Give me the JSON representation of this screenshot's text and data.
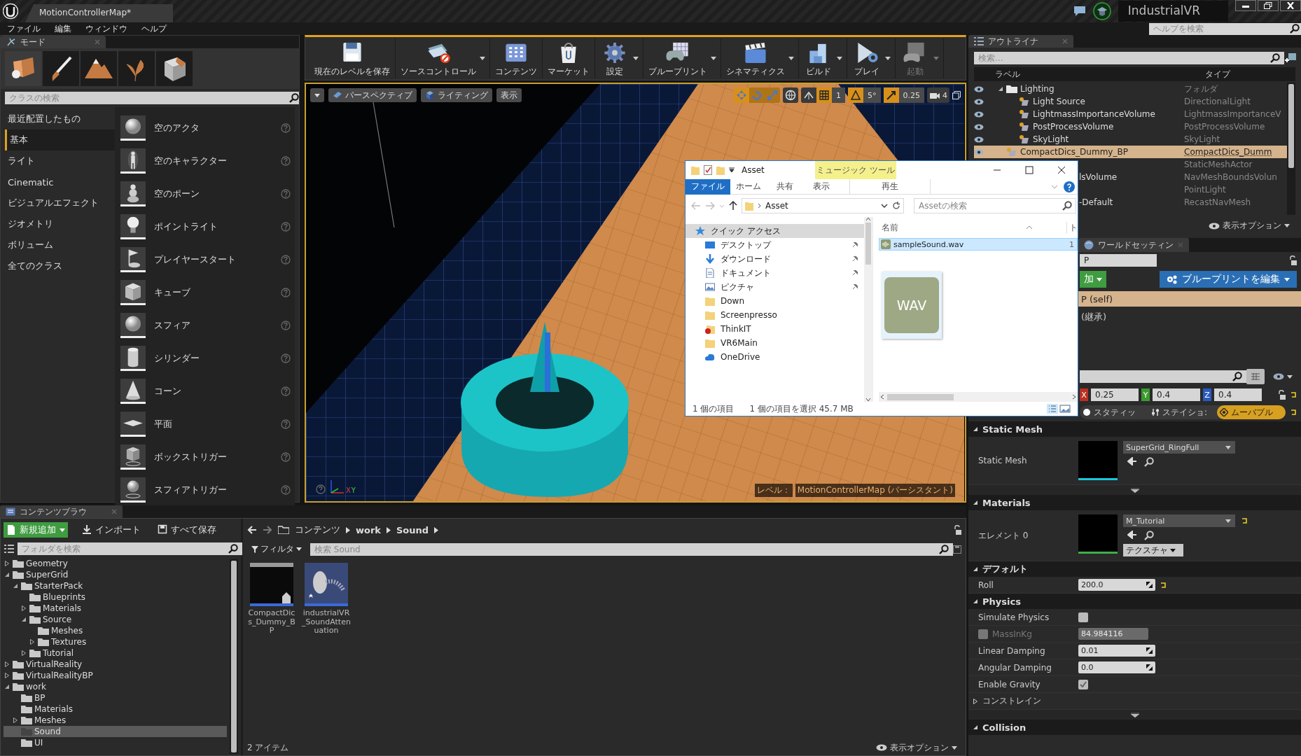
{
  "title_bar": {
    "tab": "MotionControllerMap*",
    "project": "IndustrialVR"
  },
  "menu": [
    "ファイル",
    "編集",
    "ウィンドウ",
    "ヘルプ"
  ],
  "help_search": {
    "placeholder": "ヘルプを検索"
  },
  "modes": {
    "tab": "モード",
    "tools": [
      {
        "kind": "place",
        "selected": true
      },
      {
        "kind": "paint",
        "selected": false
      },
      {
        "kind": "landscape",
        "selected": false
      },
      {
        "kind": "foliage",
        "selected": false
      },
      {
        "kind": "geometry",
        "selected": false
      }
    ],
    "search": {
      "placeholder": "クラスの検索"
    },
    "categories": [
      {
        "label": "最近配置したもの",
        "selected": false
      },
      {
        "label": "基本",
        "selected": true
      },
      {
        "label": "ライト",
        "selected": false
      },
      {
        "label": "Cinematic",
        "selected": false
      },
      {
        "label": "ビジュアルエフェクト",
        "selected": false
      },
      {
        "label": "ジオメトリ",
        "selected": false
      },
      {
        "label": "ボリューム",
        "selected": false
      },
      {
        "label": "全てのクラス",
        "selected": false
      }
    ],
    "items": [
      {
        "label": "空のアクタ",
        "kind": "sphere"
      },
      {
        "label": "空のキャラクター",
        "kind": "figure"
      },
      {
        "label": "空のポーン",
        "kind": "pawn"
      },
      {
        "label": "ポイントライト",
        "kind": "bulb"
      },
      {
        "label": "プレイヤースタート",
        "kind": "flag"
      },
      {
        "label": "キューブ",
        "kind": "cube"
      },
      {
        "label": "スフィア",
        "kind": "sphere"
      },
      {
        "label": "シリンダー",
        "kind": "cylinder"
      },
      {
        "label": "コーン",
        "kind": "cone"
      },
      {
        "label": "平面",
        "kind": "plane"
      },
      {
        "label": "ボックストリガー",
        "kind": "boxtrigger"
      },
      {
        "label": "スフィアトリガー",
        "kind": "spheretrigger"
      }
    ]
  },
  "toolbar": [
    {
      "label": "現在のレベルを保存",
      "kind": "save",
      "dropdown": false,
      "disabled": false
    },
    {
      "label": "ソースコントロール",
      "kind": "source",
      "dropdown": true,
      "disabled": false
    },
    {
      "label": "コンテンツ",
      "kind": "content",
      "dropdown": false,
      "disabled": false
    },
    {
      "label": "マーケット",
      "kind": "market",
      "dropdown": false,
      "disabled": false
    },
    {
      "label": "設定",
      "kind": "settings",
      "dropdown": true,
      "disabled": false
    },
    {
      "label": "ブループリント",
      "kind": "blueprint",
      "dropdown": true,
      "disabled": false
    },
    {
      "label": "シネマティクス",
      "kind": "cinematics",
      "dropdown": true,
      "disabled": false
    },
    {
      "label": "ビルド",
      "kind": "build",
      "dropdown": true,
      "disabled": false
    },
    {
      "label": "プレイ",
      "kind": "play",
      "dropdown": true,
      "disabled": false
    },
    {
      "label": "起動",
      "kind": "launch",
      "dropdown": true,
      "disabled": true
    }
  ],
  "viewport": {
    "buttons": [
      {
        "label": "パースペクティブ",
        "kind": "perspective"
      },
      {
        "label": "ライティング",
        "kind": "lighting"
      },
      {
        "label": "表示",
        "kind": "show"
      }
    ],
    "transform_modes": [
      {
        "kind": "move",
        "selected": true
      },
      {
        "kind": "rotate",
        "selected": false
      },
      {
        "kind": "scale",
        "selected": false
      }
    ],
    "snaps": [
      {
        "kind": "grid",
        "value": "1",
        "on": true
      },
      {
        "kind": "angle",
        "value": "5°",
        "on": true
      },
      {
        "kind": "scale",
        "value": "0.25",
        "on": true
      }
    ],
    "camera_speed": "4",
    "axis_labels": [
      "X",
      "Y"
    ],
    "level_prefix": "レベル：",
    "level_name": "MotionControllerMap (パーシスタント)"
  },
  "outliner": {
    "tab": "アウトライナ",
    "search": {
      "placeholder": "検索..."
    },
    "columns": [
      "ラベル",
      "タイプ"
    ],
    "rows": [
      {
        "label": "Lighting",
        "type": "フォルダ",
        "kind": "folder",
        "expanded": true,
        "selected": false,
        "children": [
          {
            "label": "Light Source",
            "type": "DirectionalLight",
            "kind": "actor",
            "selected": false
          },
          {
            "label": "LightmassImportanceVolume",
            "type": "LightmassImportanceV",
            "kind": "actor",
            "selected": false
          },
          {
            "label": "PostProcessVolume",
            "type": "PostProcessVolume",
            "kind": "actor",
            "selected": false
          },
          {
            "label": "SkyLight",
            "type": "SkyLight",
            "kind": "actor",
            "selected": false
          }
        ]
      },
      {
        "label": "CompactDics_Dummy_BP",
        "type": "CompactDics_Dumm",
        "kind": "actor",
        "selected": true
      },
      {
        "type": "StaticMeshActor",
        "kind": "partial",
        "selected": false
      },
      {
        "label": "lsVolume",
        "type": "NavMeshBoundsVolun",
        "kind": "partial",
        "selected": false
      },
      {
        "type": "PointLight",
        "kind": "partial",
        "selected": false
      },
      {
        "label": "-Default",
        "type": "RecastNavMesh",
        "kind": "partial",
        "selected": false
      }
    ],
    "view_options": "表示オプション"
  },
  "details": {
    "tab": "ワールドセッティン",
    "name_fragment": "P",
    "add_button": "加",
    "edit_blueprint": "ブループリントを編集",
    "components": [
      {
        "label": "P (self)",
        "selected": true
      },
      {
        "label": "(継承)",
        "selected": false
      }
    ],
    "transform": [
      {
        "axis": "X",
        "value": "0.25"
      },
      {
        "axis": "Y",
        "value": "0.4"
      },
      {
        "axis": "Z",
        "value": "0.4"
      }
    ],
    "mobility": [
      {
        "label": "スタティッ",
        "kind": "static",
        "selected": false
      },
      {
        "label": "ステイショ:",
        "kind": "stationary",
        "selected": false
      },
      {
        "label": "ムーバブル",
        "kind": "movable",
        "selected": true
      }
    ],
    "sections": [
      {
        "title": "Static Mesh",
        "expanded": true,
        "advanced": true,
        "rows": [
          {
            "kind": "asset",
            "label": "Static Mesh",
            "value": "SuperGrid_RingFull",
            "color": "#19c8dc",
            "reset": false
          }
        ]
      },
      {
        "title": "Materials",
        "expanded": true,
        "advanced": false,
        "rows": [
          {
            "kind": "asset",
            "label": "エレメント 0",
            "value": "M_Tutorial",
            "button": "テクスチャ",
            "color": "#3fae4a",
            "reset": true
          }
        ]
      },
      {
        "title": "デフォルト",
        "expanded": true,
        "advanced": false,
        "rows": [
          {
            "kind": "number",
            "label": "Roll",
            "value": "200.0",
            "reset": true
          }
        ]
      },
      {
        "title": "Physics",
        "expanded": true,
        "advanced": true,
        "rows": [
          {
            "kind": "check",
            "label": "Simulate Physics",
            "checked": false
          },
          {
            "kind": "locked",
            "label": "MassInKg",
            "value": "84.984116",
            "checked": false
          },
          {
            "kind": "number",
            "label": "Linear Damping",
            "value": "0.01",
            "reset": false
          },
          {
            "kind": "number",
            "label": "Angular Damping",
            "value": "0.0",
            "reset": false
          },
          {
            "kind": "check",
            "label": "Enable Gravity",
            "checked": true
          },
          {
            "kind": "group",
            "label": "コンストレイン",
            "expanded": false
          }
        ]
      },
      {
        "title": "Collision",
        "expanded": true,
        "advanced": false
      }
    ]
  },
  "content_browser": {
    "tab": "コンテンツブラウ",
    "buttons": [
      {
        "label": "新規追加",
        "kind": "add"
      },
      {
        "label": "インポート",
        "kind": "import"
      },
      {
        "label": "すべて保存",
        "kind": "save"
      }
    ],
    "path": [
      "コンテンツ",
      "work",
      "Sound"
    ],
    "folder_search": {
      "placeholder": "フォルダを検索"
    },
    "filter": "フィルタ",
    "asset_search": {
      "placeholder": "検索 Sound"
    },
    "tree": [
      {
        "label": "Geometry",
        "expanded": false,
        "selected": false
      },
      {
        "label": "SuperGrid",
        "expanded": true,
        "selected": false,
        "children": [
          {
            "label": "StarterPack",
            "expanded": true,
            "selected": false,
            "children": [
              {
                "label": "Blueprints",
                "selected": false
              },
              {
                "label": "Materials",
                "expanded": false,
                "selected": false
              },
              {
                "label": "Source",
                "expanded": true,
                "selected": false,
                "children": [
                  {
                    "label": "Meshes",
                    "selected": false
                  },
                  {
                    "label": "Textures",
                    "expanded": false,
                    "selected": false
                  }
                ]
              },
              {
                "label": "Tutorial",
                "expanded": false,
                "selected": false
              }
            ]
          }
        ]
      },
      {
        "label": "VirtualReality",
        "expanded": false,
        "selected": false
      },
      {
        "label": "VirtualRealityBP",
        "expanded": false,
        "selected": false
      },
      {
        "label": "work",
        "expanded": true,
        "selected": false,
        "children": [
          {
            "label": "BP",
            "selected": false
          },
          {
            "label": "Materials",
            "selected": false
          },
          {
            "label": "Meshes",
            "expanded": false,
            "selected": false
          },
          {
            "label": "Sound",
            "selected": true
          },
          {
            "label": "UI",
            "selected": false
          }
        ]
      }
    ],
    "assets": [
      {
        "label": "CompactDics_Dummy_BP",
        "kind": "blueprint"
      },
      {
        "label": "industrialVR_SoundAttenuation",
        "kind": "attenuation"
      }
    ],
    "count": "2 アイテム",
    "view_options": "表示オプション"
  },
  "explorer": {
    "title": "Asset",
    "context_tab": "ミュージック ツール",
    "ribbon": [
      {
        "label": "ファイル",
        "selected": true
      },
      {
        "label": "ホーム",
        "selected": false
      },
      {
        "label": "共有",
        "selected": false
      },
      {
        "label": "表示",
        "selected": false
      },
      {
        "label": "再生",
        "selected": false
      }
    ],
    "address": "Asset",
    "search": {
      "placeholder": "Assetの検索"
    },
    "nav": [
      {
        "label": "クイック アクセス",
        "kind": "quick",
        "pinned": false,
        "selected": true
      },
      {
        "label": "デスクトップ",
        "kind": "desktop",
        "pinned": true,
        "selected": false
      },
      {
        "label": "ダウンロード",
        "kind": "download",
        "pinned": true,
        "selected": false
      },
      {
        "label": "ドキュメント",
        "kind": "document",
        "pinned": true,
        "selected": false
      },
      {
        "label": "ピクチャ",
        "kind": "picture",
        "pinned": true,
        "selected": false
      },
      {
        "label": "Down",
        "kind": "folder",
        "pinned": false,
        "selected": false
      },
      {
        "label": "Screenpresso",
        "kind": "folder",
        "pinned": false,
        "selected": false
      },
      {
        "label": "ThinkIT",
        "kind": "warning",
        "pinned": false,
        "selected": false
      },
      {
        "label": "VR6Main",
        "kind": "folder",
        "pinned": false,
        "selected": false
      },
      {
        "label": "OneDrive",
        "kind": "cloud",
        "pinned": false,
        "selected": false
      }
    ],
    "columns": [
      "名前",
      "ト"
    ],
    "files": [
      {
        "name": "sampleSound.wav",
        "size": "1",
        "selected": true
      }
    ],
    "preview": "WAV",
    "status": [
      "1 個の項目",
      "1 個の項目を選択  45.7 MB"
    ]
  }
}
